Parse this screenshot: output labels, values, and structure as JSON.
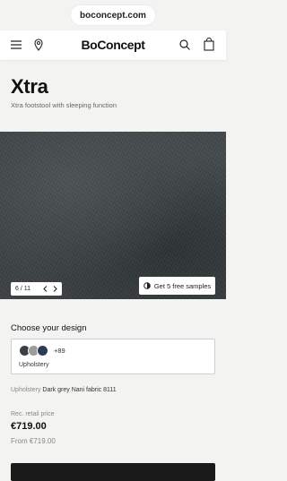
{
  "browser": {
    "url": "boconcept.com"
  },
  "header": {
    "logo": "BoConcept"
  },
  "product": {
    "title": "Xtra",
    "subtitle": "Xtra footstool with sleeping function"
  },
  "gallery": {
    "counter": "6 / 11",
    "samples_label": "Get 5 free samples"
  },
  "design": {
    "heading": "Choose your design",
    "swatch_colors": [
      "#3a3f44",
      "#9c9d9a",
      "#2c3a55"
    ],
    "more_count": "+89",
    "label": "Upholstery"
  },
  "upholstery": {
    "label": "Upholstery",
    "value": "Dark grey Nani fabric 8111"
  },
  "price": {
    "label": "Rec. retail price",
    "amount": "€719.00",
    "from": "From €719.00"
  },
  "colors": {
    "background": "#f3f3f1",
    "cta": "#1a1a1a"
  }
}
